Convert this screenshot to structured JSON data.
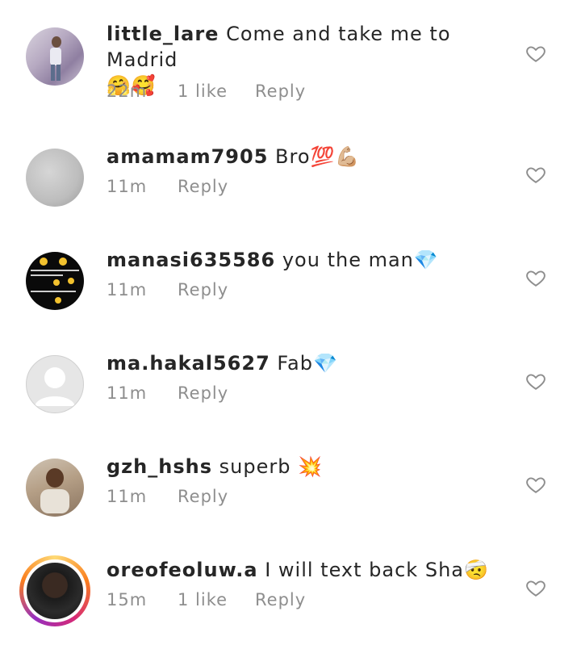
{
  "comments": [
    {
      "username": "little_lare",
      "text": "Come and take me to Madrid",
      "emojis": "🤗🥰",
      "time": "22m",
      "likes": "1 like",
      "reply": "Reply"
    },
    {
      "username": "amamam7905",
      "text": "Bro",
      "emojis": "💯💪🏼",
      "time": "11m",
      "likes": "",
      "reply": "Reply"
    },
    {
      "username": "manasi635586",
      "text": "you the man",
      "emojis": "💎",
      "time": "11m",
      "likes": "",
      "reply": "Reply"
    },
    {
      "username": "ma.hakal5627",
      "text": "Fab",
      "emojis": "💎",
      "time": "11m",
      "likes": "",
      "reply": "Reply"
    },
    {
      "username": "gzh_hshs",
      "text": "superb",
      "emojis": "💥",
      "time": "11m",
      "likes": "",
      "reply": "Reply"
    },
    {
      "username": "oreofeoluw.a",
      "text": "I will text back Sha",
      "emojis": "🤕",
      "time": "15m",
      "likes": "1 like",
      "reply": "Reply"
    }
  ],
  "icons": {
    "like": "heart-outline-icon"
  },
  "colors": {
    "text": "#262626",
    "muted": "#8e8e8e",
    "story_ring": [
      "#feda75",
      "#fa7e1e",
      "#d62976",
      "#962fbf"
    ]
  }
}
